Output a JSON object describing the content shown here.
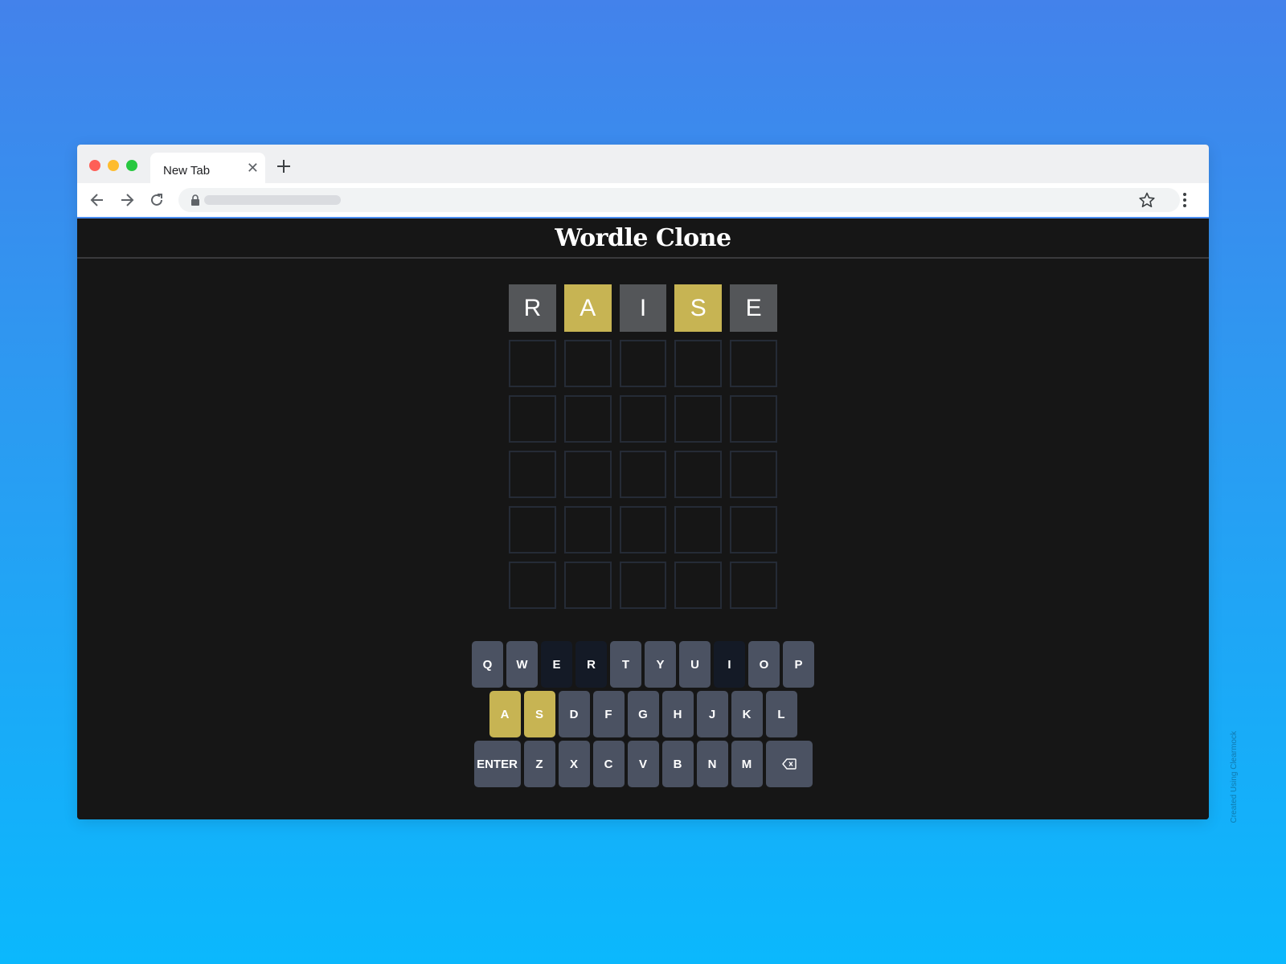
{
  "browser": {
    "tab_title": "New Tab",
    "tab_close_glyph": "✕"
  },
  "app": {
    "title": "Wordle Clone"
  },
  "board": {
    "rows": [
      [
        {
          "letter": "R",
          "state": "absent"
        },
        {
          "letter": "A",
          "state": "present"
        },
        {
          "letter": "I",
          "state": "absent"
        },
        {
          "letter": "S",
          "state": "present"
        },
        {
          "letter": "E",
          "state": "absent"
        }
      ],
      [
        {
          "letter": "",
          "state": "empty"
        },
        {
          "letter": "",
          "state": "empty"
        },
        {
          "letter": "",
          "state": "empty"
        },
        {
          "letter": "",
          "state": "empty"
        },
        {
          "letter": "",
          "state": "empty"
        }
      ],
      [
        {
          "letter": "",
          "state": "empty"
        },
        {
          "letter": "",
          "state": "empty"
        },
        {
          "letter": "",
          "state": "empty"
        },
        {
          "letter": "",
          "state": "empty"
        },
        {
          "letter": "",
          "state": "empty"
        }
      ],
      [
        {
          "letter": "",
          "state": "empty"
        },
        {
          "letter": "",
          "state": "empty"
        },
        {
          "letter": "",
          "state": "empty"
        },
        {
          "letter": "",
          "state": "empty"
        },
        {
          "letter": "",
          "state": "empty"
        }
      ],
      [
        {
          "letter": "",
          "state": "empty"
        },
        {
          "letter": "",
          "state": "empty"
        },
        {
          "letter": "",
          "state": "empty"
        },
        {
          "letter": "",
          "state": "empty"
        },
        {
          "letter": "",
          "state": "empty"
        }
      ],
      [
        {
          "letter": "",
          "state": "empty"
        },
        {
          "letter": "",
          "state": "empty"
        },
        {
          "letter": "",
          "state": "empty"
        },
        {
          "letter": "",
          "state": "empty"
        },
        {
          "letter": "",
          "state": "empty"
        }
      ]
    ]
  },
  "keyboard": {
    "rows": [
      [
        {
          "label": "Q",
          "state": "unused"
        },
        {
          "label": "W",
          "state": "unused"
        },
        {
          "label": "E",
          "state": "absent"
        },
        {
          "label": "R",
          "state": "absent"
        },
        {
          "label": "T",
          "state": "unused"
        },
        {
          "label": "Y",
          "state": "unused"
        },
        {
          "label": "U",
          "state": "unused"
        },
        {
          "label": "I",
          "state": "absent"
        },
        {
          "label": "O",
          "state": "unused"
        },
        {
          "label": "P",
          "state": "unused"
        }
      ],
      [
        {
          "label": "A",
          "state": "present"
        },
        {
          "label": "S",
          "state": "present"
        },
        {
          "label": "D",
          "state": "unused"
        },
        {
          "label": "F",
          "state": "unused"
        },
        {
          "label": "G",
          "state": "unused"
        },
        {
          "label": "H",
          "state": "unused"
        },
        {
          "label": "J",
          "state": "unused"
        },
        {
          "label": "K",
          "state": "unused"
        },
        {
          "label": "L",
          "state": "unused"
        }
      ],
      [
        {
          "label": "ENTER",
          "state": "unused",
          "kind": "enter"
        },
        {
          "label": "Z",
          "state": "unused"
        },
        {
          "label": "X",
          "state": "unused"
        },
        {
          "label": "C",
          "state": "unused"
        },
        {
          "label": "V",
          "state": "unused"
        },
        {
          "label": "B",
          "state": "unused"
        },
        {
          "label": "N",
          "state": "unused"
        },
        {
          "label": "M",
          "state": "unused"
        },
        {
          "label": "",
          "state": "unused",
          "kind": "backspace",
          "icon": "backspace-icon"
        }
      ]
    ]
  },
  "colors": {
    "present": "#c7b453",
    "absent_tile": "#545659",
    "absent_key": "#141a26",
    "unused_key": "#4b5262",
    "page_bg": "#161616"
  },
  "watermark": "Created Using Clearmock"
}
